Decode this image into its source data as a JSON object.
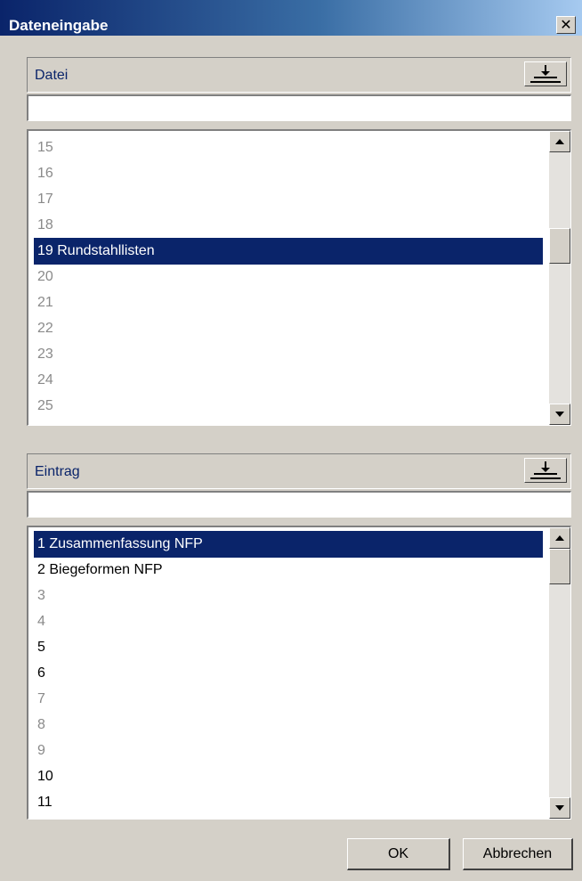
{
  "window": {
    "title": "Dateneingabe",
    "close_label": "✕"
  },
  "datei": {
    "label": "Datei",
    "input_value": "",
    "items": [
      {
        "text": "15",
        "state": "dim"
      },
      {
        "text": "16",
        "state": "dim"
      },
      {
        "text": "17",
        "state": "dim"
      },
      {
        "text": "18",
        "state": "dim"
      },
      {
        "text": "19 Rundstahllisten",
        "state": "selected"
      },
      {
        "text": "20",
        "state": "dim"
      },
      {
        "text": "21",
        "state": "dim"
      },
      {
        "text": "22",
        "state": "dim"
      },
      {
        "text": "23",
        "state": "dim"
      },
      {
        "text": "24",
        "state": "dim"
      },
      {
        "text": "25",
        "state": "dim"
      }
    ],
    "scroll_position": 0.35
  },
  "eintrag": {
    "label": "Eintrag",
    "input_value": "",
    "items": [
      {
        "text": "1 Zusammenfassung NFP",
        "state": "selected"
      },
      {
        "text": "2 Biegeformen NFP",
        "state": "normal"
      },
      {
        "text": "3",
        "state": "dim"
      },
      {
        "text": "4",
        "state": "dim"
      },
      {
        "text": "5",
        "state": "normal"
      },
      {
        "text": "6",
        "state": "normal"
      },
      {
        "text": "7",
        "state": "dim"
      },
      {
        "text": "8",
        "state": "dim"
      },
      {
        "text": "9",
        "state": "dim"
      },
      {
        "text": "10",
        "state": "normal"
      },
      {
        "text": "11",
        "state": "normal"
      }
    ],
    "scroll_position": 0.0
  },
  "buttons": {
    "ok": "OK",
    "cancel": "Abbrechen"
  },
  "icons": {
    "import": "import-arrow-icon",
    "scroll_up": "arrow-up-icon",
    "scroll_down": "arrow-down-icon",
    "close": "close-icon"
  },
  "colors": {
    "selection": "#0a246a",
    "dim_text": "#8a8a8a",
    "label_text": "#0a246a"
  }
}
